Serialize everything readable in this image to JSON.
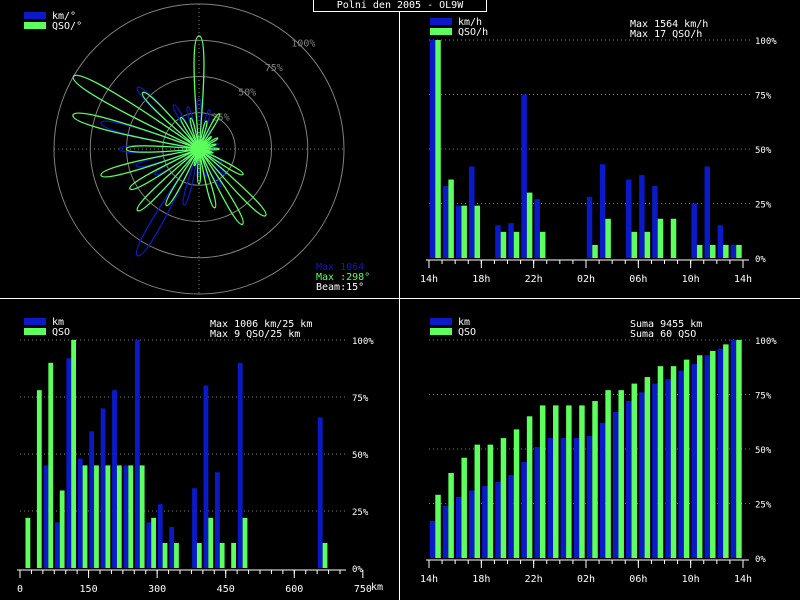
{
  "title": "Polni den 2005 - OL9W",
  "colors": {
    "blue": "#0a1ac8",
    "green": "#5cff5c",
    "grid": "#808080",
    "text": "#ffffff",
    "bg": "#000000"
  },
  "percent_ticks": [
    "100%",
    "75%",
    "50%",
    "25%",
    "0%"
  ],
  "chart_data": [
    {
      "id": "polar",
      "type": "polar",
      "legend": [
        "km/°",
        "QSO/°"
      ],
      "ring_labels": [
        "100%",
        "75%",
        "50%",
        "25%"
      ],
      "info": [
        "Max 1064",
        "Max :298°",
        "Beam:15°"
      ],
      "directions_deg": [
        0,
        15,
        30,
        45,
        60,
        75,
        90,
        105,
        120,
        135,
        150,
        165,
        180,
        195,
        210,
        225,
        240,
        255,
        270,
        285,
        300,
        315,
        330,
        345
      ],
      "series": [
        {
          "name": "km/°",
          "values": [
            35,
            28,
            15,
            10,
            12,
            14,
            10,
            10,
            18,
            25,
            30,
            20,
            18,
            40,
            85,
            60,
            35,
            45,
            55,
            70,
            100,
            60,
            35,
            30
          ]
        },
        {
          "name": "QSO/°",
          "values": [
            78,
            20,
            28,
            12,
            15,
            12,
            14,
            10,
            35,
            65,
            60,
            42,
            24,
            12,
            45,
            60,
            55,
            70,
            50,
            90,
            100,
            55,
            25,
            22
          ]
        }
      ]
    },
    {
      "id": "hourly",
      "type": "bar",
      "legend": [
        "km/h",
        "QSO/h"
      ],
      "info": [
        "Max  1564 km/h",
        "Max   17 QSO/h"
      ],
      "x_tick_labels": [
        "14h",
        "18h",
        "22h",
        "02h",
        "06h",
        "10h",
        "14h"
      ],
      "ylim": [
        0,
        100
      ],
      "series": [
        {
          "name": "km/h",
          "values": [
            100,
            33,
            24,
            42,
            0,
            15,
            16,
            75,
            27,
            0,
            0,
            0,
            28,
            43,
            0,
            36,
            38,
            33,
            0,
            0,
            25,
            42,
            15,
            6
          ]
        },
        {
          "name": "QSO/h",
          "values": [
            100,
            36,
            24,
            24,
            0,
            12,
            12,
            30,
            12,
            0,
            0,
            0,
            6,
            18,
            0,
            12,
            12,
            18,
            18,
            0,
            6,
            6,
            6,
            6
          ]
        }
      ]
    },
    {
      "id": "distance",
      "type": "bar",
      "legend": [
        "km",
        "QSO"
      ],
      "info": [
        "Max  1006 km/25 km",
        "Max    9 QSO/25 km"
      ],
      "x_tick_labels": [
        "0",
        "150",
        "300",
        "450",
        "600",
        "750"
      ],
      "x_unit": "km",
      "ylim": [
        0,
        100
      ],
      "series": [
        {
          "name": "km",
          "values": [
            0,
            0,
            45,
            20,
            92,
            48,
            60,
            70,
            78,
            45,
            100,
            20,
            28,
            18,
            0,
            35,
            80,
            42,
            0,
            90,
            0,
            0,
            0,
            0,
            0,
            0,
            66,
            0
          ]
        },
        {
          "name": "QSO",
          "values": [
            22,
            78,
            90,
            34,
            100,
            45,
            45,
            45,
            45,
            45,
            45,
            22,
            11,
            11,
            0,
            11,
            22,
            11,
            11,
            22,
            0,
            0,
            0,
            0,
            0,
            0,
            11,
            0
          ]
        }
      ]
    },
    {
      "id": "cumulative",
      "type": "bar",
      "legend": [
        "km",
        "QSO"
      ],
      "info": [
        "Suma   9455 km",
        "Suma    60 QSO"
      ],
      "x_tick_labels": [
        "14h",
        "18h",
        "22h",
        "02h",
        "06h",
        "10h",
        "14h"
      ],
      "ylim": [
        0,
        100
      ],
      "series": [
        {
          "name": "km",
          "values": [
            17,
            24,
            28,
            31,
            33,
            35,
            38,
            44,
            51,
            55,
            55,
            55,
            56,
            62,
            67,
            72,
            76,
            80,
            82,
            86,
            89,
            93,
            96,
            100
          ]
        },
        {
          "name": "QSO",
          "values": [
            29,
            39,
            46,
            52,
            52,
            55,
            59,
            65,
            70,
            70,
            70,
            70,
            72,
            77,
            77,
            80,
            83,
            88,
            88,
            91,
            93,
            95,
            98,
            100
          ]
        }
      ]
    }
  ]
}
